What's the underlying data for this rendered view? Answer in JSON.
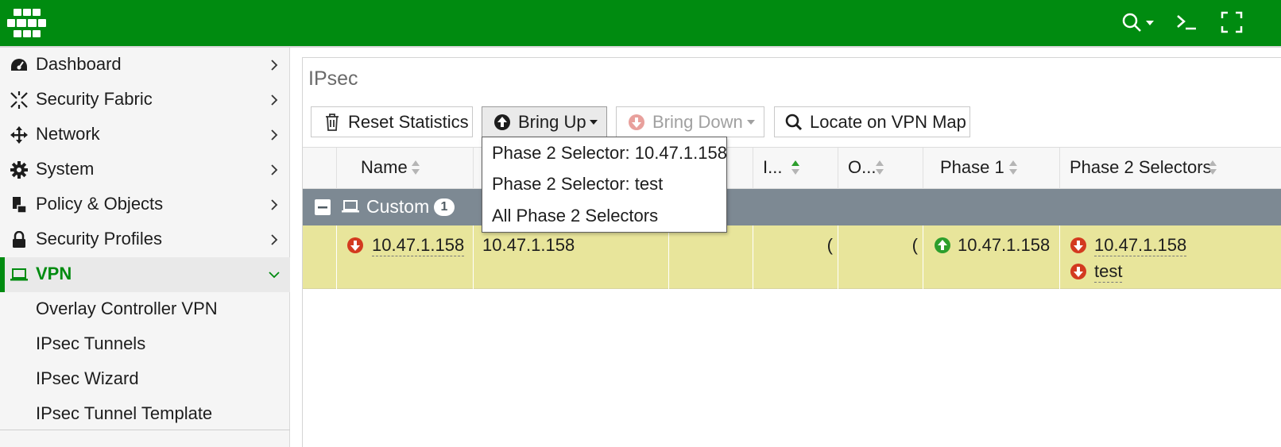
{
  "topbar": {
    "brand_color": "#008b10",
    "icons": [
      "fortinet-logo-icon",
      "search-icon",
      "cli-console-icon",
      "fullscreen-icon"
    ]
  },
  "sidebar": {
    "items": [
      {
        "label": "Dashboard",
        "icon": "dashboard-icon"
      },
      {
        "label": "Security Fabric",
        "icon": "security-fabric-icon"
      },
      {
        "label": "Network",
        "icon": "network-icon"
      },
      {
        "label": "System",
        "icon": "gear-icon"
      },
      {
        "label": "Policy & Objects",
        "icon": "policy-icon"
      },
      {
        "label": "Security Profiles",
        "icon": "lock-icon"
      },
      {
        "label": "VPN",
        "icon": "laptop-icon",
        "active": true
      }
    ],
    "vpn_subitems": [
      {
        "label": "Overlay Controller VPN"
      },
      {
        "label": "IPsec Tunnels"
      },
      {
        "label": "IPsec Wizard"
      },
      {
        "label": "IPsec Tunnel Template"
      }
    ]
  },
  "page": {
    "title": "IPsec"
  },
  "toolbar": {
    "reset_label": "Reset Statistics",
    "bring_up_label": "Bring Up",
    "bring_down_label": "Bring Down",
    "locate_label": "Locate on VPN Map"
  },
  "table": {
    "columns": [
      "Name",
      "I...",
      "O...",
      "Phase 1",
      "Phase 2 Selectors"
    ],
    "group": {
      "label": "Custom",
      "count": "1"
    },
    "row": {
      "name": "10.47.1.158",
      "remote_gateway": "10.47.1.158",
      "incoming_partial": "(",
      "outgoing_partial": "(",
      "phase1": "10.47.1.158",
      "phase2_selectors": [
        "10.47.1.158",
        "test"
      ]
    }
  },
  "dropdown": {
    "items": [
      "Phase 2 Selector: 10.47.1.158",
      "Phase 2 Selector: test",
      "All Phase 2 Selectors"
    ]
  },
  "colors": {
    "status_up": "#2c9e2c",
    "status_down": "#d33a1f",
    "row_highlight": "#e8e59b",
    "group_header": "#7d8993"
  }
}
